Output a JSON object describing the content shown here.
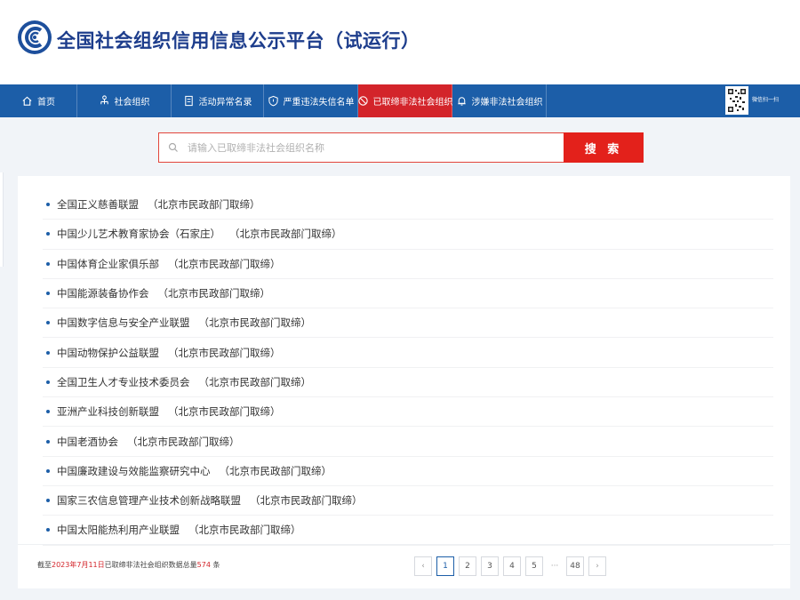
{
  "header": {
    "site_title": "全国社会组织信用信息公示平台（试运行）"
  },
  "nav": {
    "items": [
      {
        "label": "首页",
        "icon": "home-icon"
      },
      {
        "label": "社会组织",
        "icon": "org-tree-icon"
      },
      {
        "label": "活动异常名录",
        "icon": "document-icon"
      },
      {
        "label": "严重违法失信名单",
        "icon": "shield-icon"
      },
      {
        "label": "已取缔非法社会组织",
        "icon": "ban-icon",
        "active": true
      },
      {
        "label": "涉嫌非法社会组织",
        "icon": "bell-icon"
      }
    ],
    "qr_label": "微信扫一扫"
  },
  "search": {
    "placeholder": "请输入已取缔非法社会组织名称",
    "button_label": "搜 索"
  },
  "list": [
    {
      "name": "全国正义慈善联盟",
      "dept": "（北京市民政部门取缔）"
    },
    {
      "name": "中国少儿艺术教育家协会（石家庄）",
      "dept": "（北京市民政部门取缔）"
    },
    {
      "name": "中国体育企业家俱乐部",
      "dept": "（北京市民政部门取缔）"
    },
    {
      "name": "中国能源装备协作会",
      "dept": "（北京市民政部门取缔）"
    },
    {
      "name": "中国数字信息与安全产业联盟",
      "dept": "（北京市民政部门取缔）"
    },
    {
      "name": "中国动物保护公益联盟",
      "dept": "（北京市民政部门取缔）"
    },
    {
      "name": "全国卫生人才专业技术委员会",
      "dept": "（北京市民政部门取缔）"
    },
    {
      "name": "亚洲产业科技创新联盟",
      "dept": "（北京市民政部门取缔）"
    },
    {
      "name": "中国老酒协会",
      "dept": "（北京市民政部门取缔）"
    },
    {
      "name": "中国廉政建设与效能监察研究中心",
      "dept": "（北京市民政部门取缔）"
    },
    {
      "name": "国家三农信息管理产业技术创新战略联盟",
      "dept": "（北京市民政部门取缔）"
    },
    {
      "name": "中国太阳能热利用产业联盟",
      "dept": "（北京市民政部门取缔）"
    }
  ],
  "stats": {
    "prefix": "截至",
    "date": "2023年7月11日",
    "middle": "已取缔非法社会组织数据总量",
    "count": "574",
    "suffix": "条"
  },
  "pager": {
    "prev": "‹",
    "pages": [
      "1",
      "2",
      "3",
      "4",
      "5"
    ],
    "ellipsis": "···",
    "last": "48",
    "next": "›",
    "current": "1"
  },
  "colors": {
    "nav_bg": "#1c5ea8",
    "active_nav": "#d3242a",
    "search_button": "#e3211b",
    "title": "#1d3d8c"
  }
}
